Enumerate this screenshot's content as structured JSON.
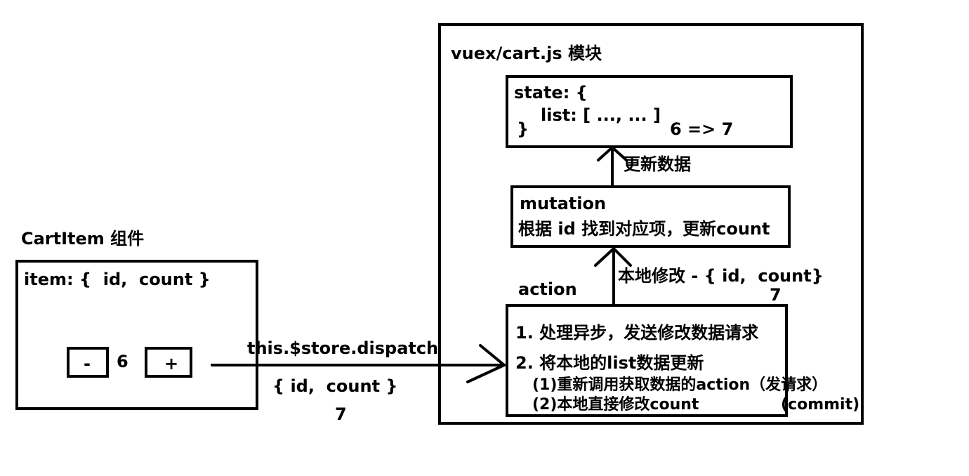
{
  "colors": {
    "ink": "#000000",
    "background": "#ffffff"
  },
  "component": {
    "heading": "CartItem 组件",
    "item_text": "item: {  id,  count }",
    "minus_label": "-",
    "count_value": "6",
    "plus_label": "+"
  },
  "dispatch": {
    "call": "this.$store.dispatch",
    "payload": "{ id,  count }",
    "new_value": "7"
  },
  "module": {
    "heading": "vuex/cart.js 模块",
    "state": {
      "line1": "state: {",
      "line2": "list: [ ..., ... ]",
      "line3": "}",
      "change": "6 => 7"
    },
    "update_label": "更新数据",
    "mutation": {
      "title": "mutation",
      "desc": "根据 id 找到对应项，更新count"
    },
    "local_edit": {
      "label": "本地修改 - { id,  count}",
      "value": "7"
    },
    "action": {
      "title": "action",
      "line1": "1. 处理异步，发送修改数据请求",
      "line2": "2. 将本地的list数据更新",
      "line3": "(1)重新调用获取数据的action（发请求）",
      "line4": "(2)本地直接修改count",
      "line4_note": "(commit)"
    }
  }
}
